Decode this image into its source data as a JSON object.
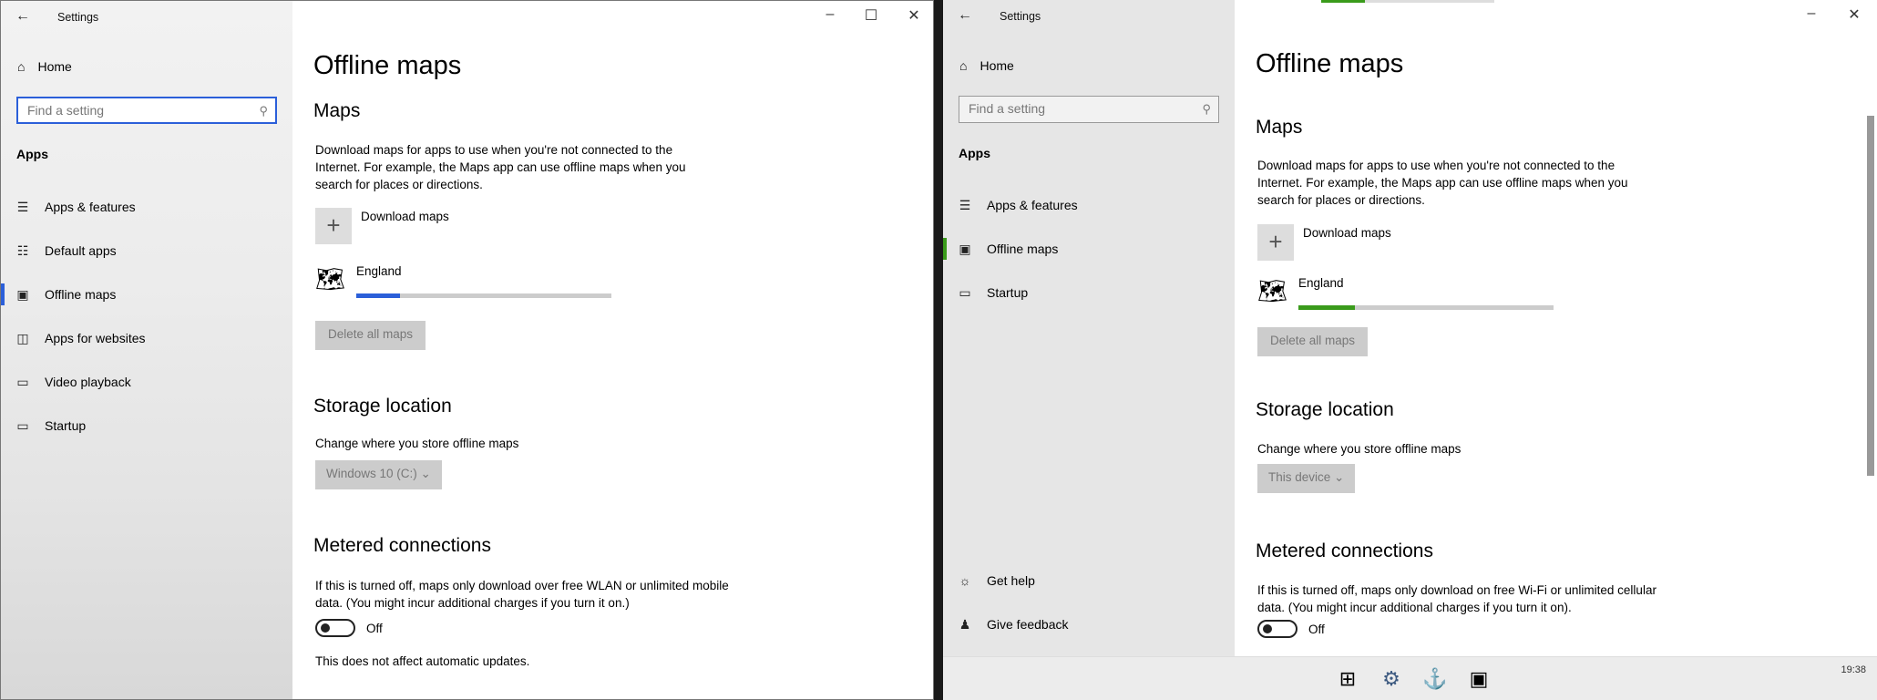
{
  "windows": [
    {
      "title": "Settings",
      "home": "Home",
      "search_placeholder": "Find a setting",
      "section": "Apps",
      "nav": [
        "Apps & features",
        "Default apps",
        "Offline maps",
        "Apps for websites",
        "Video playback",
        "Startup"
      ],
      "selected": "Offline maps",
      "page_title": "Offline maps",
      "maps_heading": "Maps",
      "maps_desc": "Download maps for apps to use when you're not connected to the Internet. For example, the Maps app can use offline maps when you search for places or directions.",
      "download_label": "Download maps",
      "map_name": "England",
      "map_progress": 0.17,
      "delete_label": "Delete all maps",
      "storage_heading": "Storage location",
      "storage_desc": "Change where you store offline maps",
      "storage_value": "Windows 10 (C:)",
      "metered_heading": "Metered connections",
      "metered_desc": "If this is turned off, maps only download over free WLAN or unlimited mobile data. (You might incur additional charges if you turn it on.)",
      "toggle_state": "Off",
      "footer_note": "This does not affect automatic updates.",
      "accent": "#2b5fd9"
    },
    {
      "title": "Settings",
      "home": "Home",
      "search_placeholder": "Find a setting",
      "section": "Apps",
      "nav": [
        "Apps & features",
        "Offline maps",
        "Startup"
      ],
      "bottom_nav": [
        "Get help",
        "Give feedback"
      ],
      "selected": "Offline maps",
      "page_title": "Offline maps",
      "maps_heading": "Maps",
      "maps_desc": "Download maps for apps to use when you're not connected to the Internet. For example, the Maps app can use offline maps when you search for places or directions.",
      "download_label": "Download maps",
      "map_name": "England",
      "map_progress": 0.22,
      "delete_label": "Delete all maps",
      "storage_heading": "Storage location",
      "storage_desc": "Change where you store offline maps",
      "storage_value": "This device",
      "metered_heading": "Metered connections",
      "metered_desc": "If this is turned off, maps only download on free Wi-Fi or unlimited cellular data. (You might incur additional charges if you turn it on).",
      "toggle_state": "Off",
      "accent": "#3a9b1b",
      "clock": "19:38"
    }
  ]
}
